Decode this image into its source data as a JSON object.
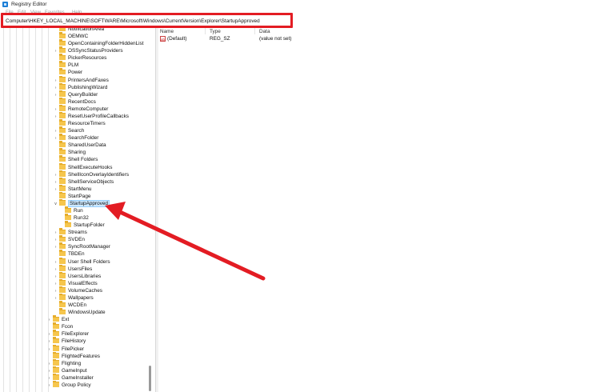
{
  "window": {
    "title": "Registry Editor",
    "icon": "registry-editor-icon"
  },
  "menu": [
    "File",
    "Edit",
    "View",
    "Favorites",
    "Help"
  ],
  "address": {
    "path": "Computer\\HKEY_LOCAL_MACHINE\\SOFTWARE\\Microsoft\\Windows\\CurrentVersion\\Explorer\\StartupApproved"
  },
  "tree": {
    "items": [
      {
        "label": "NotificationArea",
        "expand": false
      },
      {
        "label": "OEMWC",
        "expand": false
      },
      {
        "label": "OpenContainingFolderHiddenList",
        "expand": false
      },
      {
        "label": "OSSyncStatusProviders",
        "expand": true
      },
      {
        "label": "PickerResources",
        "expand": false
      },
      {
        "label": "PLM",
        "expand": false
      },
      {
        "label": "Power",
        "expand": false
      },
      {
        "label": "PrintersAndFaxes",
        "expand": true
      },
      {
        "label": "PublishingWizard",
        "expand": true
      },
      {
        "label": "QueryBuilder",
        "expand": true
      },
      {
        "label": "RecentDocs",
        "expand": false
      },
      {
        "label": "RemoteComputer",
        "expand": true
      },
      {
        "label": "ResetUserProfileCallbacks",
        "expand": true
      },
      {
        "label": "ResourceTimers",
        "expand": false
      },
      {
        "label": "Search",
        "expand": true
      },
      {
        "label": "SearchFolder",
        "expand": true
      },
      {
        "label": "SharedUserData",
        "expand": false
      },
      {
        "label": "Sharing",
        "expand": false
      },
      {
        "label": "Shell Folders",
        "expand": false
      },
      {
        "label": "ShellExecuteHooks",
        "expand": false
      },
      {
        "label": "ShellIconOverlayIdentifiers",
        "expand": true
      },
      {
        "label": "ShellServiceObjects",
        "expand": true
      },
      {
        "label": "StartMenu",
        "expand": true
      },
      {
        "label": "StartPage",
        "expand": false
      },
      {
        "label": "StartupApproved",
        "expand": "open"
      },
      {
        "label": "Run",
        "expand": false
      },
      {
        "label": "Run32",
        "expand": false
      },
      {
        "label": "StartupFolder",
        "expand": false
      },
      {
        "label": "Streams",
        "expand": true
      },
      {
        "label": "SVDEn",
        "expand": true
      },
      {
        "label": "SyncRootManager",
        "expand": true
      },
      {
        "label": "TBDEn",
        "expand": false
      },
      {
        "label": "User Shell Folders",
        "expand": true
      },
      {
        "label": "UsersFiles",
        "expand": true
      },
      {
        "label": "UsersLibraries",
        "expand": true
      },
      {
        "label": "VisualEffects",
        "expand": true
      },
      {
        "label": "VolumeCaches",
        "expand": true
      },
      {
        "label": "Wallpapers",
        "expand": true
      },
      {
        "label": "WCDEn",
        "expand": false
      },
      {
        "label": "WindowsUpdate",
        "expand": false
      },
      {
        "label": "Ext",
        "expand": true
      },
      {
        "label": "Fcon",
        "expand": false
      },
      {
        "label": "FileExplorer",
        "expand": true
      },
      {
        "label": "FileHistory",
        "expand": true
      },
      {
        "label": "FilePicker",
        "expand": true
      },
      {
        "label": "FlightedFeatures",
        "expand": false
      },
      {
        "label": "Flighting",
        "expand": true
      },
      {
        "label": "GameInput",
        "expand": true
      },
      {
        "label": "GameInstaller",
        "expand": true
      },
      {
        "label": "Group Policy",
        "expand": true
      }
    ]
  },
  "values_list": {
    "columns": [
      "Name",
      "Type",
      "Data"
    ],
    "rows": [
      {
        "name": "(Default)",
        "type": "REG_SZ",
        "data": "(value not set)"
      }
    ]
  },
  "colors": {
    "highlight": "#e31c23",
    "arrow": "#e31c23",
    "selection": "#cce8ff",
    "folder": "#f6c64d"
  }
}
